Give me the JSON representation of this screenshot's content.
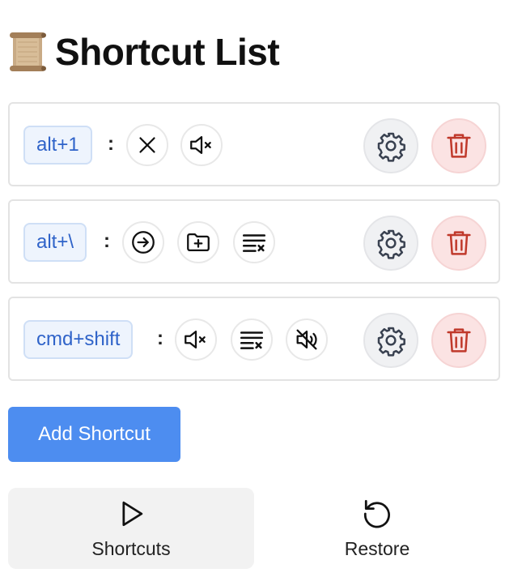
{
  "header": {
    "title": "Shortcut List",
    "icon": "scroll-icon"
  },
  "shortcuts": [
    {
      "key": "alt+1",
      "separator": ":",
      "actions": [
        "close-icon",
        "volume-mute-icon"
      ]
    },
    {
      "key": "alt+\\",
      "separator": ":",
      "actions": [
        "arrow-right-circle-icon",
        "folder-plus-icon",
        "clear-list-icon"
      ]
    },
    {
      "key": "cmd+shift",
      "separator": ":",
      "actions": [
        "volume-mute-icon",
        "clear-list-icon",
        "volume-off-icon"
      ]
    }
  ],
  "add_button": {
    "label": "Add Shortcut"
  },
  "bottom_nav": [
    {
      "label": "Shortcuts",
      "icon": "play-icon",
      "active": true
    },
    {
      "label": "Restore",
      "icon": "restore-icon",
      "active": false
    }
  ],
  "colors": {
    "accent": "#4d8df0",
    "badge_text": "#2f63c9",
    "delete": "#c0392b"
  }
}
